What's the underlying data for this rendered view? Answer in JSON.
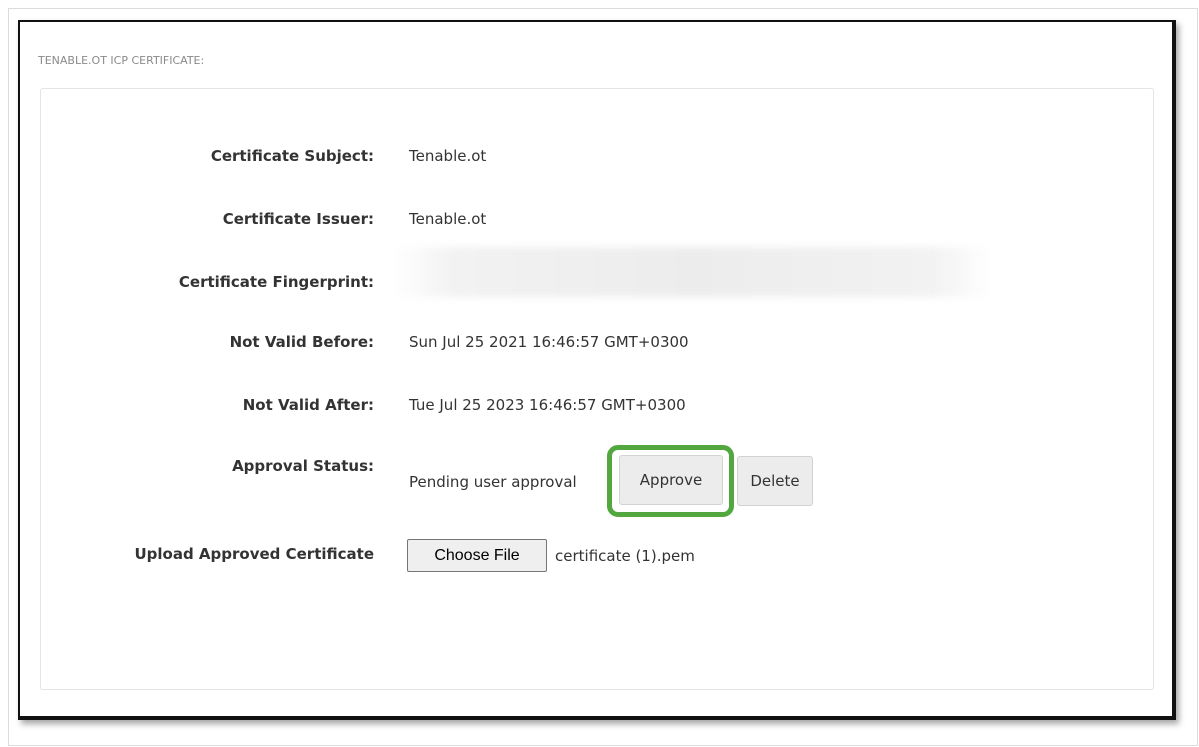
{
  "section": {
    "title": "TENABLE.OT ICP CERTIFICATE:"
  },
  "fields": {
    "subject": {
      "label": "Certificate Subject:",
      "value": "Tenable.ot"
    },
    "issuer": {
      "label": "Certificate Issuer:",
      "value": "Tenable.ot"
    },
    "fingerprint": {
      "label": "Certificate Fingerprint:",
      "value": ""
    },
    "not_valid_before": {
      "label": "Not Valid Before:",
      "value": "Sun Jul 25 2021 16:46:57 GMT+0300"
    },
    "not_valid_after": {
      "label": "Not Valid After:",
      "value": "Tue Jul 25 2023 16:46:57 GMT+0300"
    },
    "approval_status": {
      "label": "Approval Status:",
      "value": "Pending user approval"
    },
    "upload": {
      "label": "Upload Approved Certificate"
    }
  },
  "actions": {
    "approve_label": "Approve",
    "delete_label": "Delete"
  },
  "file_input": {
    "button_label": "Choose File",
    "selected_file": "certificate (1).pem"
  },
  "colors": {
    "highlight": "#52a73e",
    "label_text": "#333333",
    "section_title": "#8a8a8a"
  }
}
